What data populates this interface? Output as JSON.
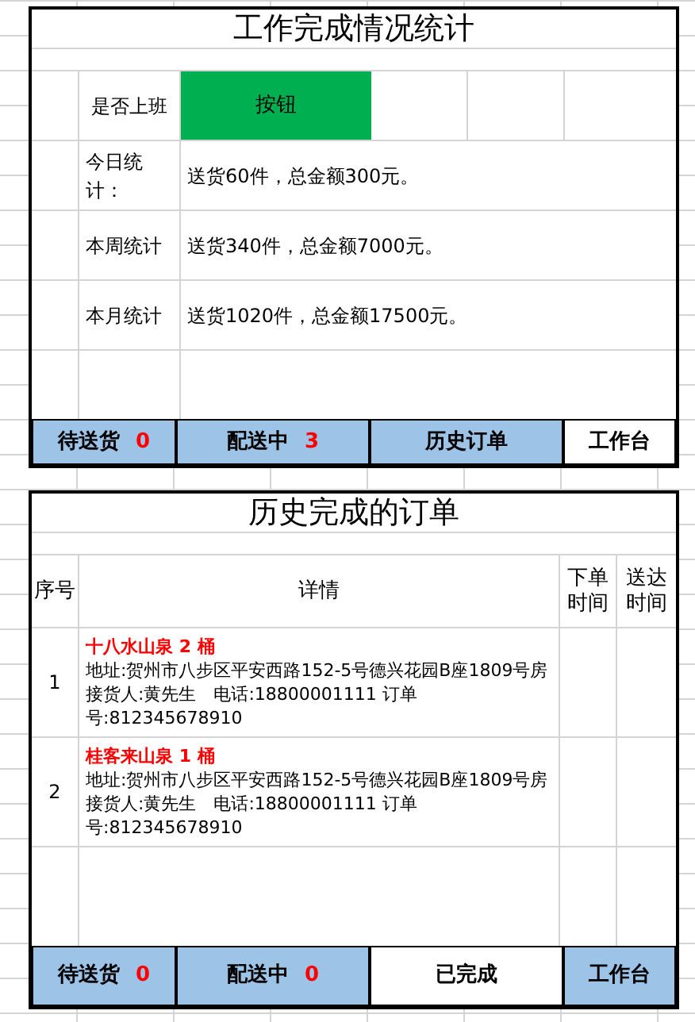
{
  "work_stats": {
    "title": "工作完成情况统计",
    "on_duty": {
      "label": "是否上班",
      "button": "按钮"
    },
    "stats": [
      {
        "label": "今日统计：",
        "value": "送货60件，总金额300元。"
      },
      {
        "label": "本周统计",
        "value": "送货340件，总金额7000元。"
      },
      {
        "label": "本月统计",
        "value": "送货1020件，总金额17500元。"
      }
    ],
    "tabs": [
      {
        "label": "待送货",
        "count": "0",
        "selected": false
      },
      {
        "label": "配送中",
        "count": "3",
        "selected": false
      },
      {
        "label": "历史订单",
        "selected": false
      },
      {
        "label": "工作台",
        "selected": true
      }
    ]
  },
  "history": {
    "title": "历史完成的订单",
    "columns": [
      "序号",
      "详情",
      "下单时间",
      "送达时间"
    ],
    "rows": [
      {
        "index": "1",
        "product": "十八水山泉 2 桶",
        "address": "地址:贺州市八步区平安西路152-5号德兴花园B座1809号房",
        "contact": "接货人:黄先生　电话:18800001111 订单号:812345678910"
      },
      {
        "index": "2",
        "product": "桂客来山泉 1 桶",
        "address": "地址:贺州市八步区平安西路152-5号德兴花园B座1809号房",
        "contact": "接货人:黄先生　电话:18800001111 订单号:812345678910"
      }
    ],
    "tabs": [
      {
        "label": "待送货",
        "count": "0",
        "selected": false
      },
      {
        "label": "配送中",
        "count": "0",
        "selected": false
      },
      {
        "label": "已完成",
        "selected": true
      },
      {
        "label": "工作台",
        "selected": false
      }
    ]
  }
}
